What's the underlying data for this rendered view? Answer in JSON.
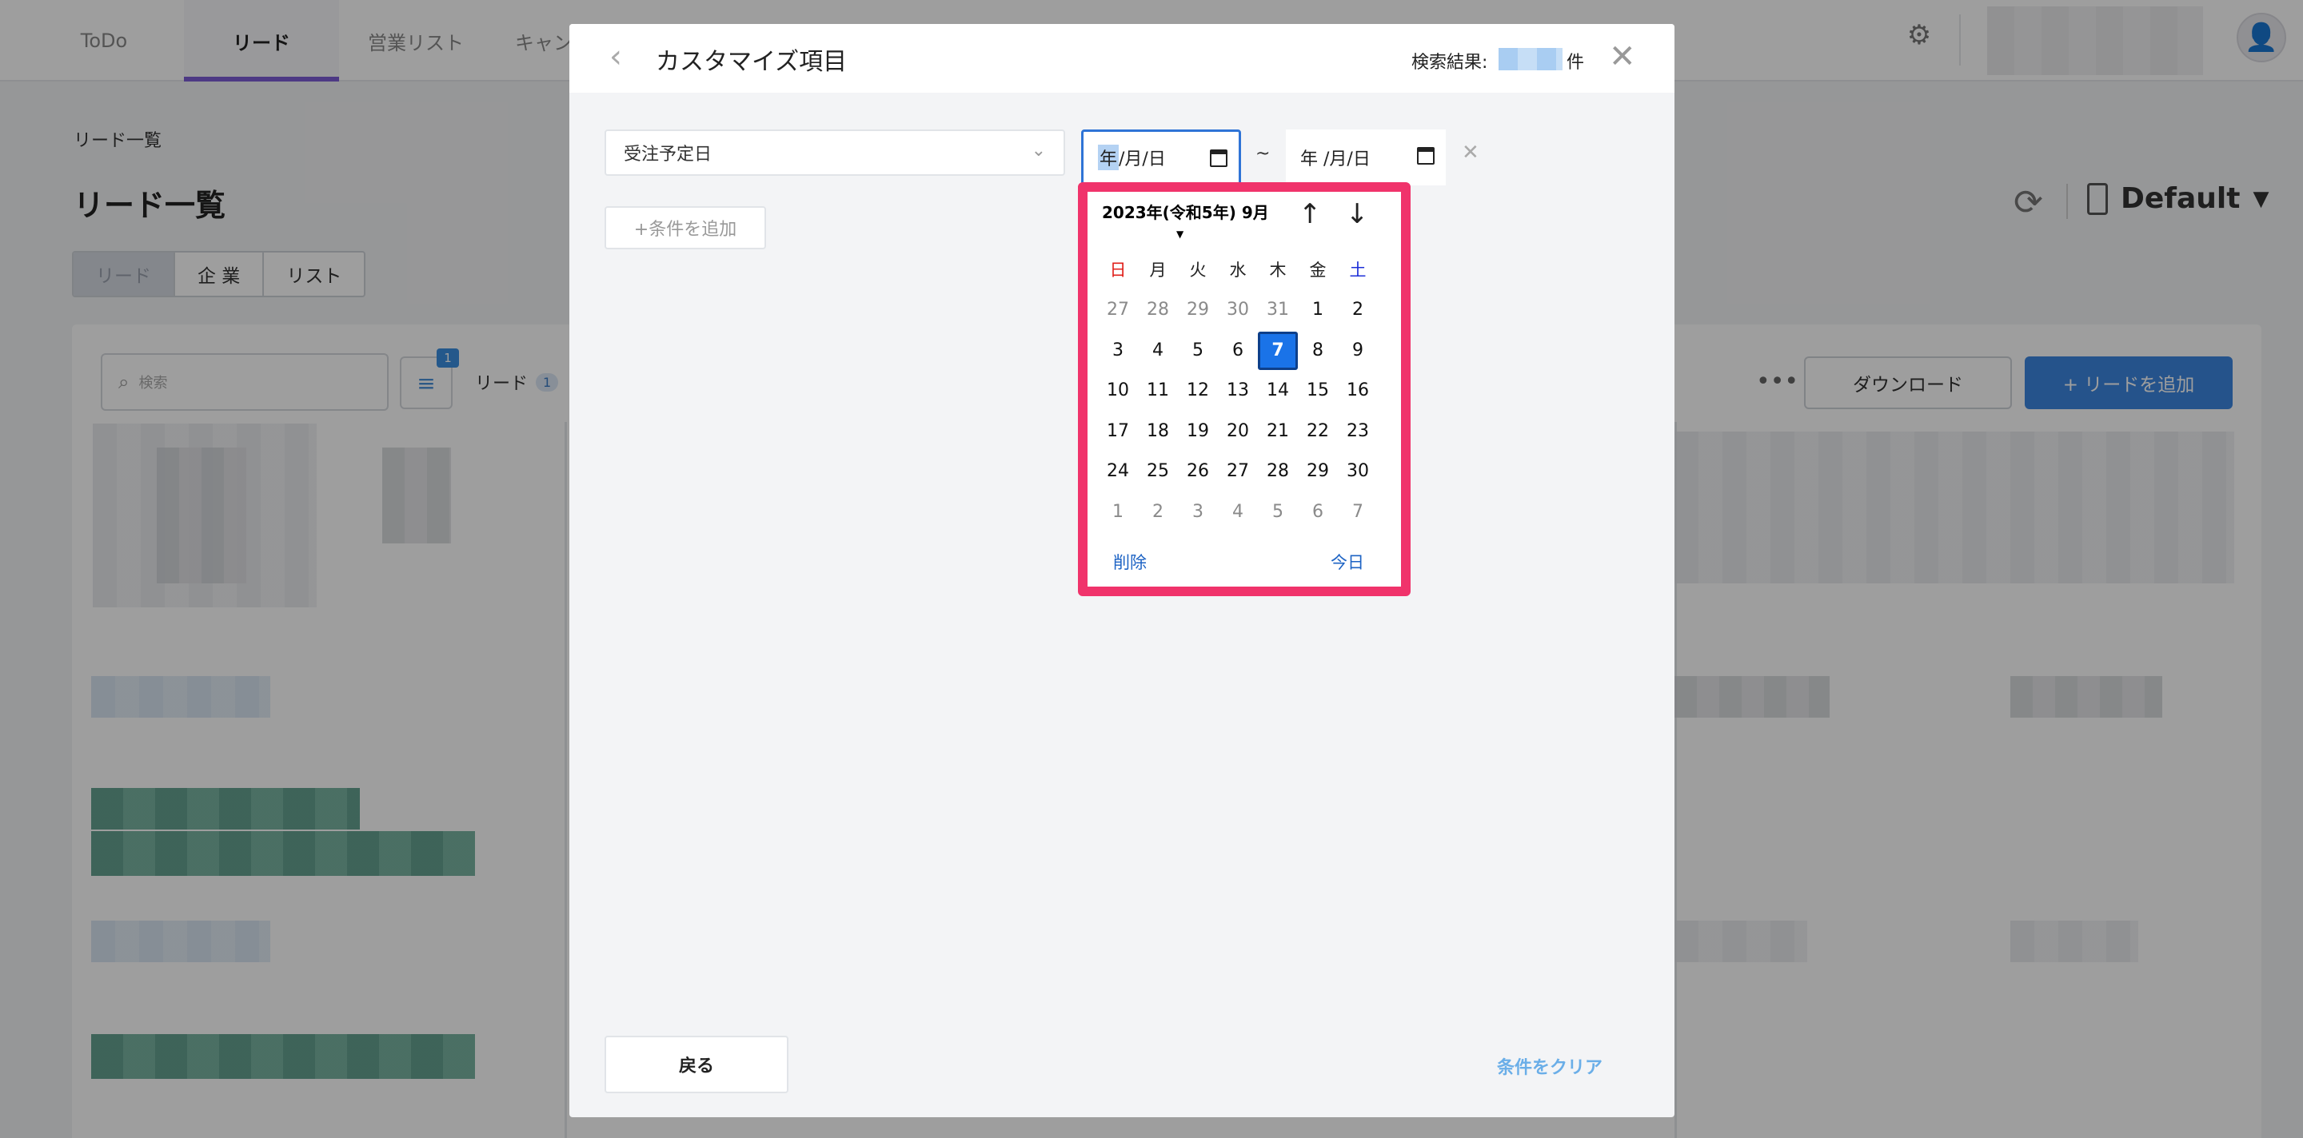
{
  "nav": {
    "tabs": [
      {
        "label": "ToDo"
      },
      {
        "label": "リード"
      },
      {
        "label": "営業リスト"
      },
      {
        "label": "キャン"
      }
    ]
  },
  "page": {
    "breadcrumb": "リード一覧",
    "title": "リード一覧",
    "segments": [
      "リード",
      "企 業",
      "リスト"
    ],
    "view_name": "Default",
    "search_placeholder": "検索",
    "filter_badge": "1",
    "lead_label": "リード",
    "lead_count": "1",
    "download_label": "ダウンロード",
    "add_lead_label": "+ リードを追加"
  },
  "modal": {
    "title": "カスタマイズ項目",
    "result_label": "検索結果:",
    "result_unit": "件",
    "field_value": "受注予定日",
    "date_from": {
      "year": "年",
      "rest": " /月/日"
    },
    "date_separator": "~",
    "date_to": "年 /月/日",
    "add_condition_label": "+条件を追加",
    "back_label": "戻る",
    "clear_label": "条件をクリア"
  },
  "datepicker": {
    "month_label": "2023年(令和5年) 9月",
    "weekdays": [
      "日",
      "月",
      "火",
      "水",
      "木",
      "金",
      "土"
    ],
    "weeks": [
      [
        {
          "d": "27",
          "m": true
        },
        {
          "d": "28",
          "m": true
        },
        {
          "d": "29",
          "m": true
        },
        {
          "d": "30",
          "m": true
        },
        {
          "d": "31",
          "m": true
        },
        {
          "d": "1"
        },
        {
          "d": "2"
        }
      ],
      [
        {
          "d": "3"
        },
        {
          "d": "4"
        },
        {
          "d": "5"
        },
        {
          "d": "6"
        },
        {
          "d": "7",
          "sel": true
        },
        {
          "d": "8"
        },
        {
          "d": "9"
        }
      ],
      [
        {
          "d": "10"
        },
        {
          "d": "11"
        },
        {
          "d": "12"
        },
        {
          "d": "13"
        },
        {
          "d": "14"
        },
        {
          "d": "15"
        },
        {
          "d": "16"
        }
      ],
      [
        {
          "d": "17"
        },
        {
          "d": "18"
        },
        {
          "d": "19"
        },
        {
          "d": "20"
        },
        {
          "d": "21"
        },
        {
          "d": "22"
        },
        {
          "d": "23"
        }
      ],
      [
        {
          "d": "24"
        },
        {
          "d": "25"
        },
        {
          "d": "26"
        },
        {
          "d": "27"
        },
        {
          "d": "28"
        },
        {
          "d": "29"
        },
        {
          "d": "30"
        }
      ],
      [
        {
          "d": "1",
          "m": true
        },
        {
          "d": "2",
          "m": true
        },
        {
          "d": "3",
          "m": true
        },
        {
          "d": "4",
          "m": true
        },
        {
          "d": "5",
          "m": true
        },
        {
          "d": "6",
          "m": true
        },
        {
          "d": "7",
          "m": true
        }
      ]
    ],
    "delete_label": "削除",
    "today_label": "今日",
    "highlight_color": "#f0336b",
    "selected_color": "#1a73e8"
  }
}
